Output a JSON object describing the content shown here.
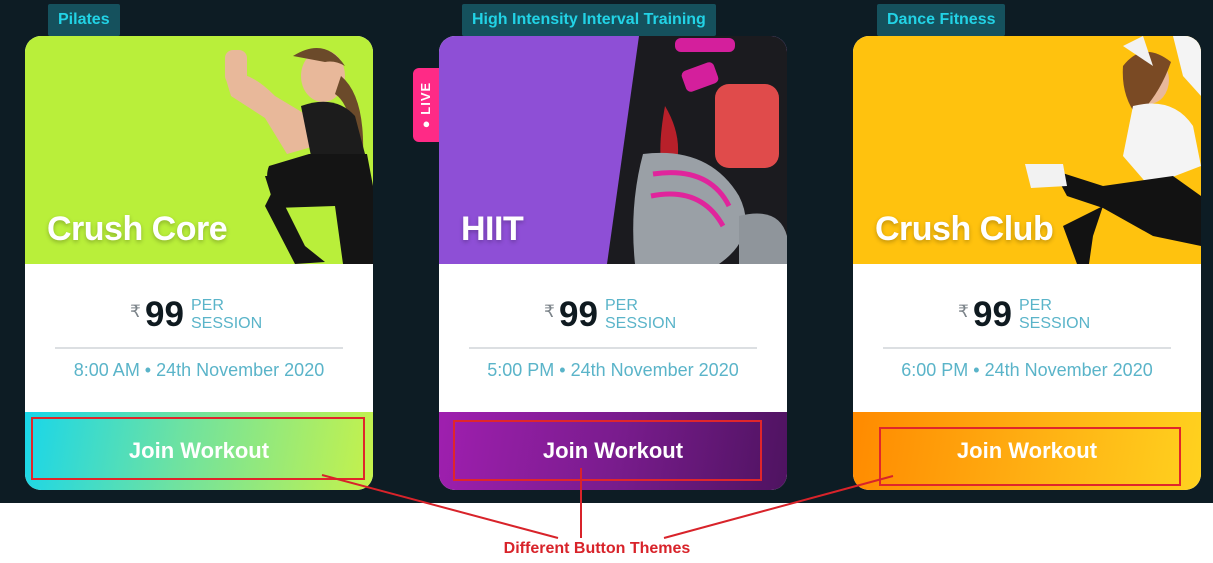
{
  "currency_symbol": "₹",
  "per_label_line1": "PER",
  "per_label_line2": "SESSION",
  "live_label": "● LIVE",
  "cards": [
    {
      "category": "Pilates",
      "title": "Crush Core",
      "price": "99",
      "time": "8:00 AM • 24th November 2020",
      "button": "Join Workout",
      "theme": "green",
      "hero_color": "#b9ef3a"
    },
    {
      "category": "High Intensity Interval Training",
      "title": "HIIT",
      "price": "99",
      "time": "5:00 PM • 24th November 2020",
      "button": "Join Workout",
      "theme": "purple",
      "hero_color": "#8e4fd6"
    },
    {
      "category": "Dance Fitness",
      "title": "Crush Club",
      "price": "99",
      "time": "6:00 PM • 24th November 2020",
      "button": "Join Workout",
      "theme": "orange",
      "hero_color": "#ffc20e"
    }
  ],
  "annotation": {
    "label": "Different Button Themes",
    "color": "#d8232a"
  }
}
